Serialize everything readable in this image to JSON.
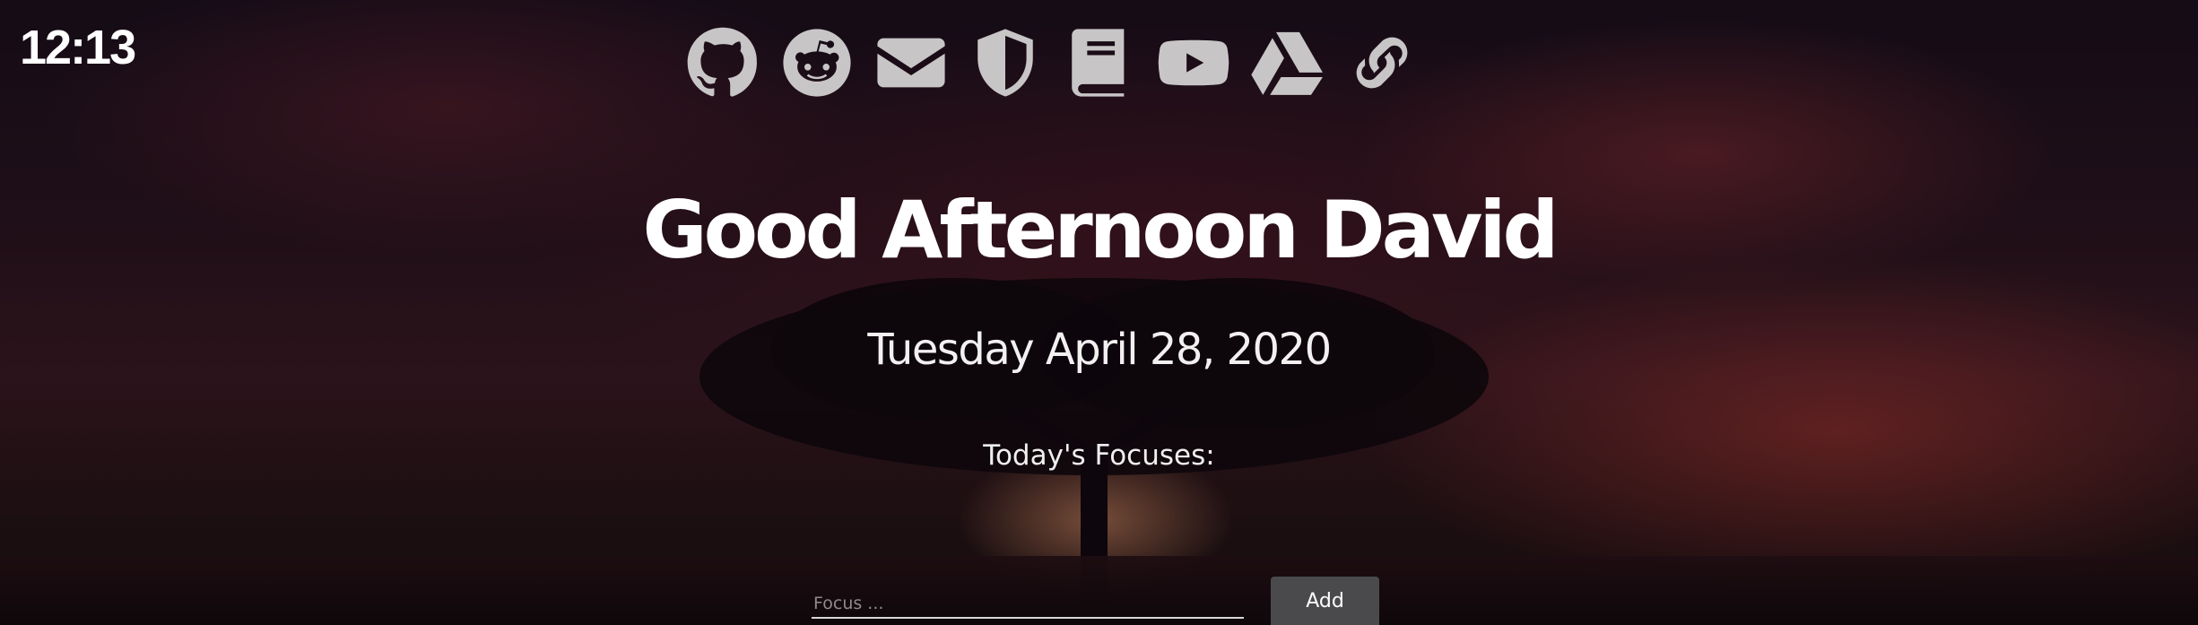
{
  "clock": {
    "time": "12:13"
  },
  "links": [
    {
      "name": "github-icon"
    },
    {
      "name": "reddit-icon"
    },
    {
      "name": "mail-icon"
    },
    {
      "name": "shield-icon"
    },
    {
      "name": "book-icon"
    },
    {
      "name": "youtube-icon"
    },
    {
      "name": "google-drive-icon"
    },
    {
      "name": "link-icon"
    }
  ],
  "greeting": {
    "text": "Good Afternoon David"
  },
  "date": {
    "text": "Tuesday April 28, 2020"
  },
  "focus": {
    "title": "Today's Focuses:",
    "placeholder": "Focus ...",
    "value": "",
    "add_label": "Add"
  },
  "colors": {
    "icon": "#c8c5c6",
    "button": "#4a4a4c",
    "text": "#ffffff"
  }
}
